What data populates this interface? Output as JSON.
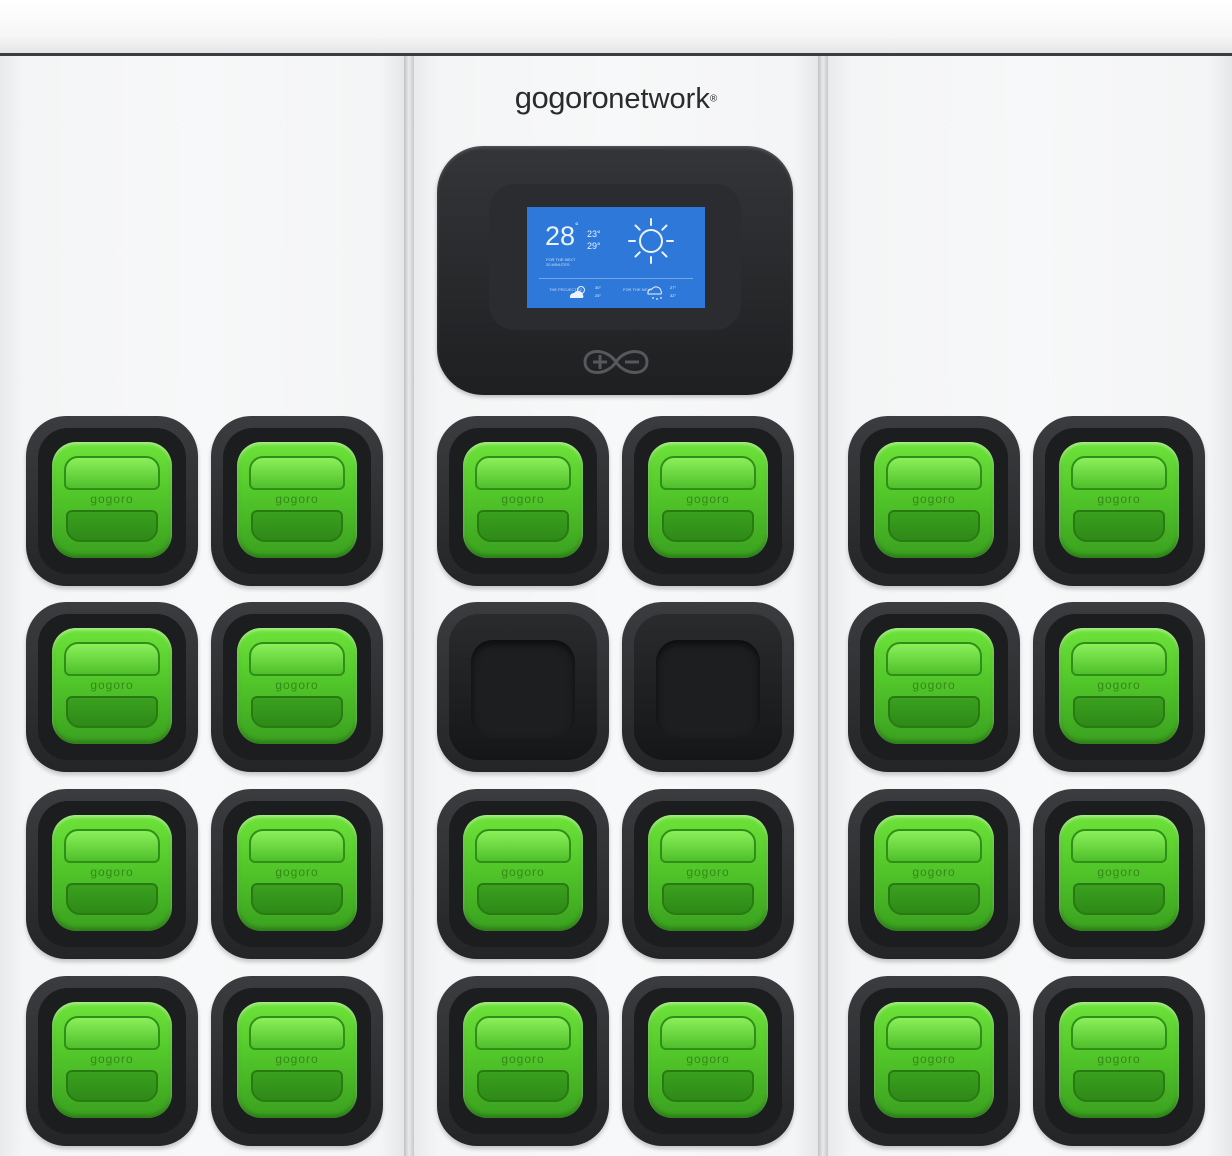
{
  "brand": {
    "name_part1": "gogoro",
    "name_part2": "network",
    "reg_mark": "®"
  },
  "screen": {
    "temperature": "28",
    "degree": "°",
    "high": "23°",
    "low": "29°",
    "note_line1": "FOR THE NEXT",
    "note_line2": "20 MINUTES",
    "forecast_left_label": "THE PROJECTED",
    "forecast_left_temp1": "30°",
    "forecast_left_temp2": "25°",
    "forecast_right_label": "FOR THE NEXT",
    "forecast_right_temp1": "27°",
    "forecast_right_temp2": "32°"
  },
  "battery_mark": "gogoro",
  "colors": {
    "battery_green": "#52c72a",
    "dock_dark": "#242527",
    "screen_blue": "#2d78d8"
  },
  "slots": [
    {
      "status": "battery"
    },
    {
      "status": "battery"
    },
    {
      "status": "battery"
    },
    {
      "status": "battery"
    },
    {
      "status": "battery"
    },
    {
      "status": "battery"
    },
    {
      "status": "battery"
    },
    {
      "status": "battery"
    },
    {
      "status": "empty"
    },
    {
      "status": "empty"
    },
    {
      "status": "battery"
    },
    {
      "status": "battery"
    },
    {
      "status": "battery"
    },
    {
      "status": "battery"
    },
    {
      "status": "battery"
    },
    {
      "status": "battery"
    },
    {
      "status": "battery"
    },
    {
      "status": "battery"
    },
    {
      "status": "battery"
    },
    {
      "status": "battery"
    },
    {
      "status": "battery"
    },
    {
      "status": "battery"
    },
    {
      "status": "battery"
    },
    {
      "status": "battery"
    }
  ]
}
